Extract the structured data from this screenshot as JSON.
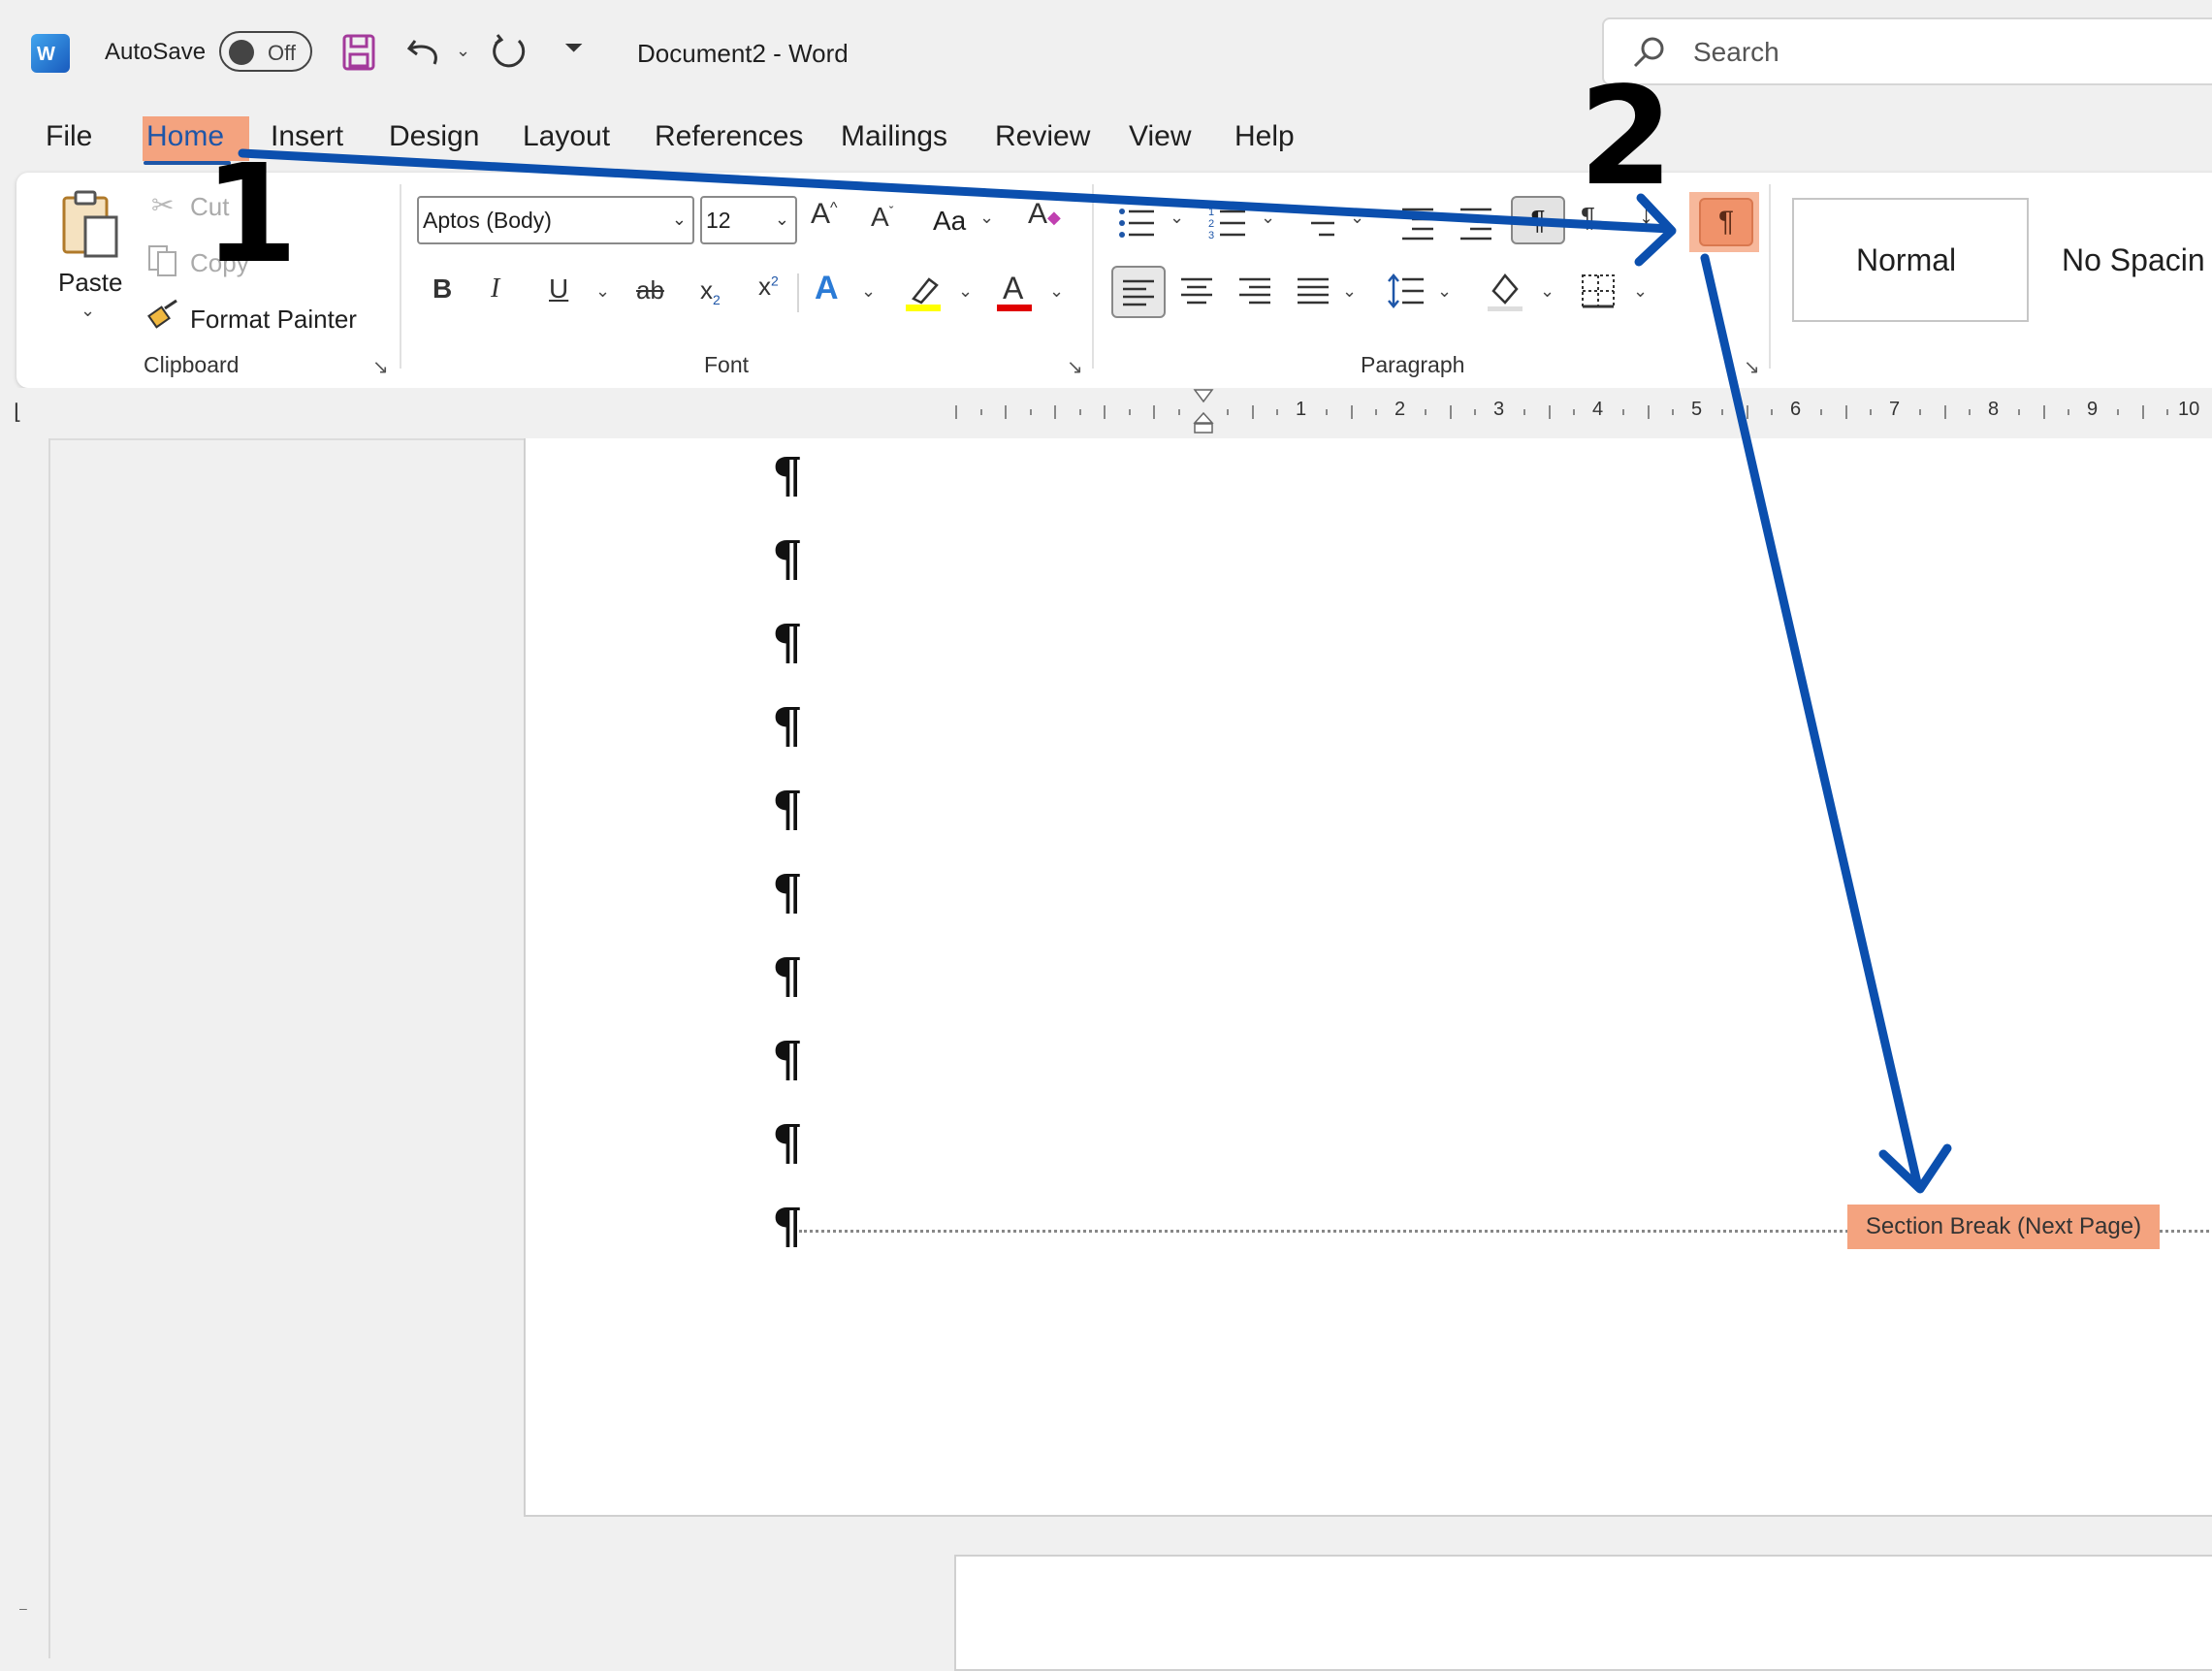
{
  "titlebar": {
    "autosave_label": "AutoSave",
    "autosave_state": "Off",
    "document_title": "Document2  -  Word",
    "search_placeholder": "Search"
  },
  "menu": [
    "File",
    "Home",
    "Insert",
    "Design",
    "Layout",
    "References",
    "Mailings",
    "Review",
    "View",
    "Help"
  ],
  "clipboard": {
    "paste": "Paste",
    "cut": "Cut",
    "copy": "Copy",
    "format_painter": "Format Painter",
    "group": "Clipboard"
  },
  "font": {
    "family": "Aptos (Body)",
    "size": "12",
    "change_case": "Aa",
    "group": "Font"
  },
  "paragraph": {
    "group": "Paragraph"
  },
  "styles": [
    "Normal",
    "No Spacin"
  ],
  "ruler": [
    "1",
    "2",
    "3",
    "4",
    "5",
    "6",
    "7",
    "8",
    "9",
    "10"
  ],
  "document": {
    "pilcrow": "¶",
    "paragraph_marks": 10,
    "section_break": "Section Break (Next Page)"
  },
  "annotations": {
    "step1": "1",
    "step2": "2",
    "arrow_color": "#0b4fae",
    "highlight_color": "#f4a37f"
  }
}
